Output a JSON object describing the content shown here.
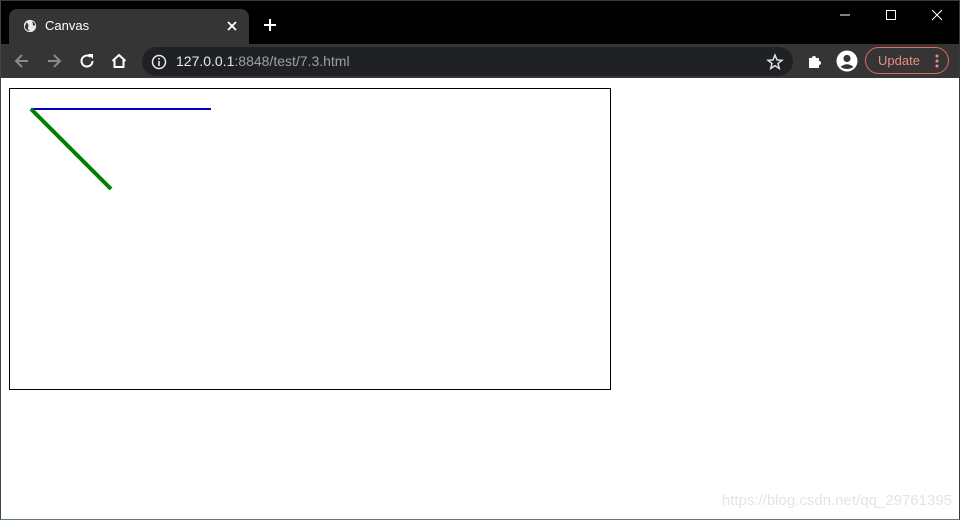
{
  "tab": {
    "title": "Canvas"
  },
  "address_bar": {
    "host": "127.0.0.1",
    "rest": ":8848/test/7.3.html"
  },
  "toolbar": {
    "update_label": "Update"
  },
  "watermark": "https://blog.csdn.net/qq_29761395",
  "canvas": {
    "lines": [
      {
        "name": "blue-line",
        "color": "#0000cc"
      },
      {
        "name": "green-line",
        "color": "#008000"
      }
    ]
  }
}
